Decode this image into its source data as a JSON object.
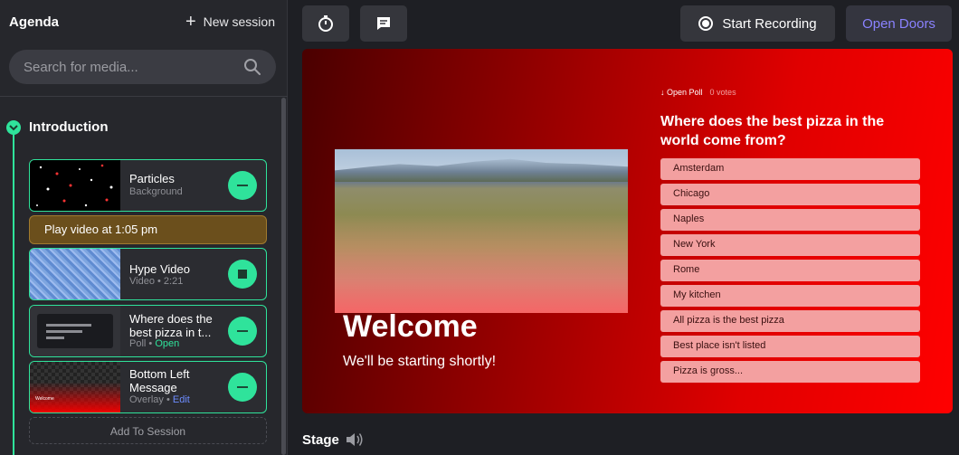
{
  "sidebar": {
    "title": "Agenda",
    "new_session_label": "New session",
    "search_placeholder": "Search for media...",
    "section_title": "Introduction",
    "cards": [
      {
        "title": "Particles",
        "subtitle": "Background"
      },
      {
        "title": "Hype Video",
        "subtitle": "Video • 2:21"
      },
      {
        "title": "Where does the best pizza in t...",
        "subtitle": "Poll •",
        "status": "Open"
      },
      {
        "title": "Bottom Left Message",
        "subtitle": "Overlay •",
        "action": "Edit",
        "thumb_text": "Welcome"
      }
    ],
    "play_banner": "Play video at 1:05 pm",
    "add_label": "Add To Session"
  },
  "toolbar": {
    "record_label": "Start Recording",
    "open_doors_label": "Open Doors"
  },
  "stage": {
    "welcome": "Welcome",
    "subtitle": "We'll be starting shortly!",
    "poll_tag": "Open Poll",
    "poll_votes": "0 votes",
    "poll_question": "Where does the best pizza in the world come from?",
    "poll_options": [
      "Amsterdam",
      "Chicago",
      "Naples",
      "New York",
      "Rome",
      "My kitchen",
      "All pizza is the best pizza",
      "Best place isn't listed",
      "Pizza is gross..."
    ],
    "label": "Stage"
  },
  "colors": {
    "accent": "#2fe39b",
    "open_doors": "#8a82ff",
    "stage_red": "#e00000"
  }
}
